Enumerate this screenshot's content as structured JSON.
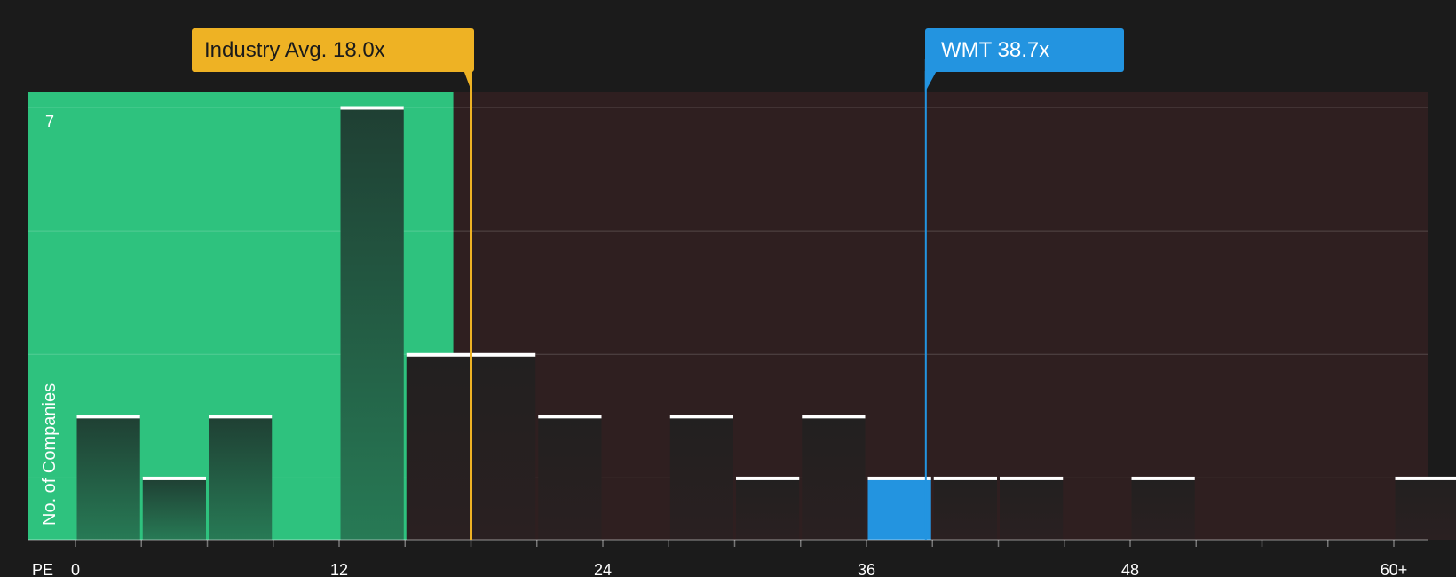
{
  "chart_data": {
    "type": "bar",
    "xlabel": "PE",
    "ylabel": "No. of Companies",
    "ymax_label": "7",
    "ylim": [
      0,
      7
    ],
    "xlim": [
      0,
      61
    ],
    "x_ticks": [
      "0",
      "12",
      "24",
      "36",
      "48",
      "60+"
    ],
    "x_tick_values": [
      0,
      12,
      24,
      36,
      48,
      60
    ],
    "bin_width": 3,
    "bins": [
      {
        "start": 0,
        "count": 2
      },
      {
        "start": 3,
        "count": 1
      },
      {
        "start": 6,
        "count": 2
      },
      {
        "start": 12,
        "count": 7
      },
      {
        "start": 15,
        "count": 3
      },
      {
        "start": 18,
        "count": 3
      },
      {
        "start": 21,
        "count": 2
      },
      {
        "start": 27,
        "count": 2
      },
      {
        "start": 30,
        "count": 1
      },
      {
        "start": 33,
        "count": 2
      },
      {
        "start": 36,
        "count": 1,
        "highlight": true
      },
      {
        "start": 39,
        "count": 1
      },
      {
        "start": 42,
        "count": 1
      },
      {
        "start": 48,
        "count": 1
      },
      {
        "start": 60,
        "count": 1
      }
    ],
    "industry_avg": {
      "label": "Industry Avg. 18.0x",
      "value": 18.0
    },
    "company": {
      "label": "WMT 38.7x",
      "value": 38.7
    },
    "undervalued_until": 17.2,
    "colors": {
      "background": "#1b1b1b",
      "undervalued_zone": "#2ec27e",
      "overvalued_zone": "#2f1f20",
      "industry_line": "#eeb224",
      "company": "#2394e0",
      "bar_cap": "#ffffff"
    }
  }
}
